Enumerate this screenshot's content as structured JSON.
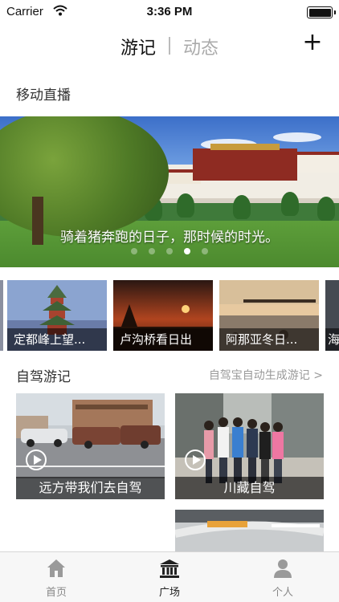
{
  "status_bar": {
    "carrier": "Carrier",
    "time": "3:36 PM",
    "wifi_icon": "wifi-icon",
    "battery_icon": "battery-icon"
  },
  "nav": {
    "active_tab": "游记",
    "inactive_tab": "动态",
    "add_icon": "plus-icon",
    "add_glyph": "+"
  },
  "live_section": {
    "title": "移动直播"
  },
  "banner": {
    "caption": "骑着猪奔跑的日子，那时候的时光。",
    "dots_count": 5,
    "active_dot": 4
  },
  "live_cards": [
    {
      "label": "定都峰上望..."
    },
    {
      "label": "卢沟桥看日出"
    },
    {
      "label": "阿那亚冬日..."
    },
    {
      "label": "海"
    }
  ],
  "drive_section": {
    "title": "自驾游记",
    "more_link": "自驾宝自动生成游记 >",
    "cards": [
      {
        "label": "远方带我们去自驾",
        "icon": "play-icon"
      },
      {
        "label": "川藏自驾",
        "icon": "play-icon"
      }
    ]
  },
  "tabbar": {
    "items": [
      {
        "label": "首页",
        "icon": "home-icon",
        "active": false
      },
      {
        "label": "广场",
        "icon": "square-temple-icon",
        "active": true
      },
      {
        "label": "个人",
        "icon": "person-icon",
        "active": false
      }
    ]
  },
  "colors": {
    "accent": "#222222",
    "inactive": "#aaaaaa",
    "tabbar_bg": "#f7f7f7"
  }
}
